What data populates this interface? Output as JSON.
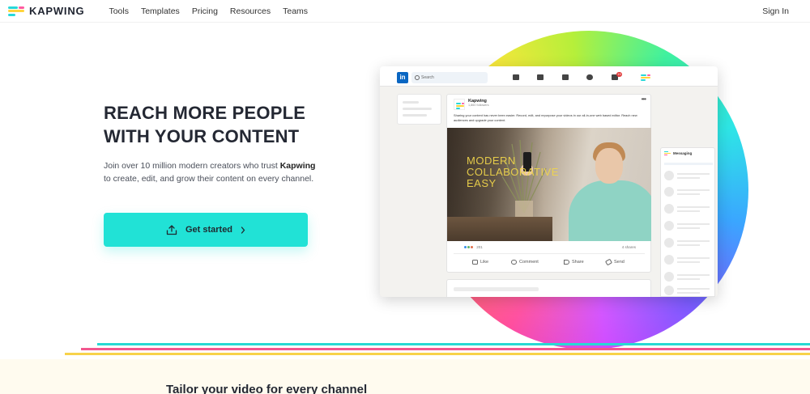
{
  "nav": {
    "brand": "KAPWING",
    "links": [
      "Tools",
      "Templates",
      "Pricing",
      "Resources",
      "Teams"
    ],
    "signin": "Sign In"
  },
  "hero": {
    "title": "REACH MORE PEOPLE WITH YOUR CONTENT",
    "subtitle_before": "Join over 10 million modern creators who trust ",
    "subtitle_brand": "Kapwing",
    "subtitle_after": " to create, edit, and grow their content on every channel.",
    "cta_label": "Get started"
  },
  "mockup": {
    "search_placeholder": "Search",
    "notification_count": "19",
    "post": {
      "author": "Kapwing",
      "followers": "1,860 followers",
      "text": "Sharing your content has never been easier. Record, edit, and repurpose your videos in our all-in-one web based editor. Reach new audiences and upgrade your content.",
      "image_text": [
        "MODERN",
        "COLLABORATIVE",
        "EASY"
      ],
      "reactions_count": "201",
      "shares": "4 shares",
      "actions": [
        "Like",
        "Comment",
        "Share",
        "Send"
      ]
    },
    "messaging_label": "Messaging"
  },
  "section": {
    "title": "Tailor your video for every channel"
  },
  "colors": {
    "brand_cyan": "#21e2d6",
    "brand_pink": "#f2578e",
    "brand_yellow": "#f7d24a",
    "linkedin_blue": "#0a66c2"
  }
}
